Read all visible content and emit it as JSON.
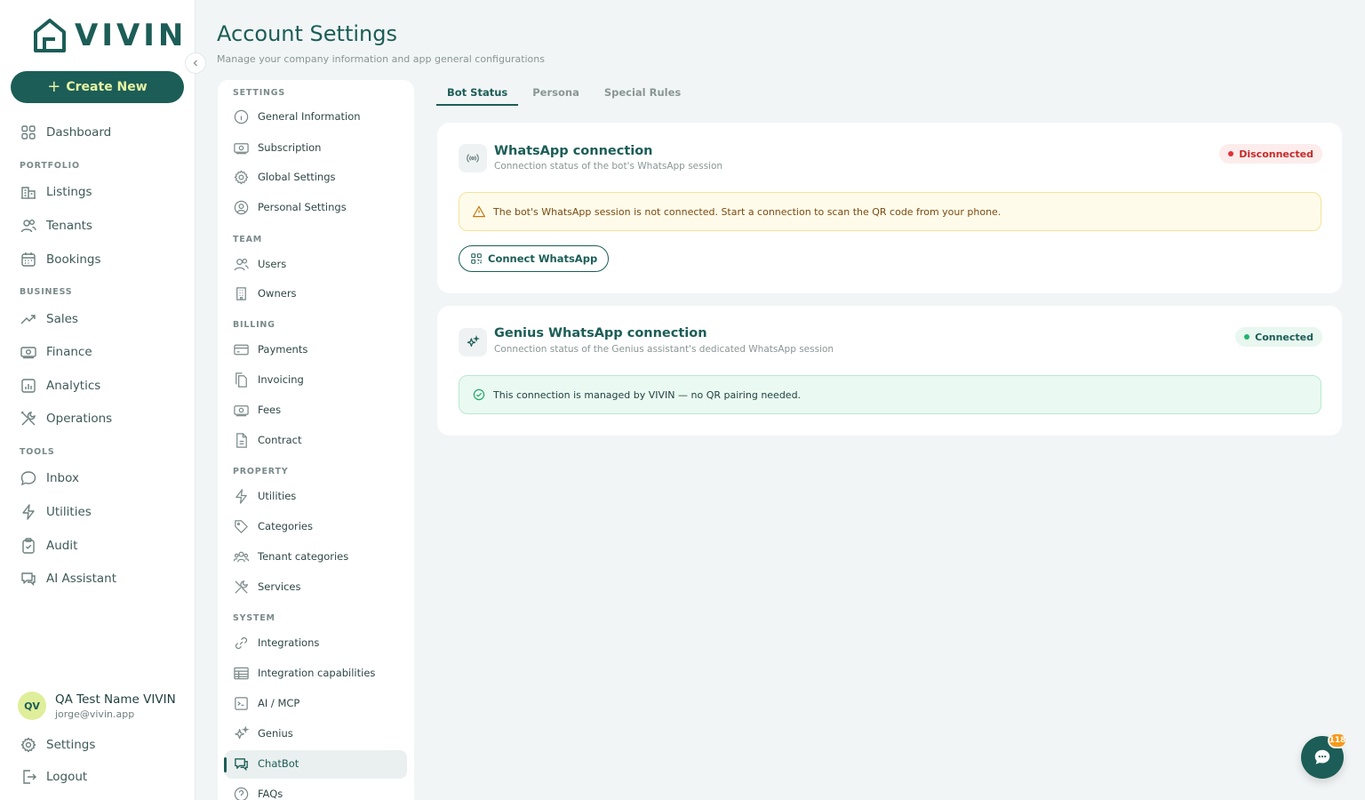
{
  "app": {
    "logo_text": "VIVIN",
    "brand_color": "#1c5e57",
    "accent_color": "#e7f3a3"
  },
  "sidebar": {
    "create_label": "Create New",
    "items": {
      "dashboard": "Dashboard",
      "portfolio_section": "PORTFOLIO",
      "listings": "Listings",
      "tenants": "Tenants",
      "bookings": "Bookings",
      "business_section": "BUSINESS",
      "sales": "Sales",
      "finance": "Finance",
      "analytics": "Analytics",
      "operations": "Operations",
      "tools_section": "TOOLS",
      "inbox": "Inbox",
      "utilities": "Utilities",
      "audit": "Audit",
      "ai_assistant": "AI Assistant"
    },
    "user": {
      "initials": "QV",
      "name": "QA Test Name VIVIN",
      "email": "jorge@vivin.app"
    },
    "settings_label": "Settings",
    "logout_label": "Logout"
  },
  "header": {
    "title": "Account Settings",
    "subtitle": "Manage your company information and app general configurations"
  },
  "settings_menu": {
    "settings_section": "SETTINGS",
    "general_information": "General Information",
    "subscription": "Subscription",
    "global_settings": "Global Settings",
    "personal_settings": "Personal Settings",
    "team_section": "TEAM",
    "users": "Users",
    "owners": "Owners",
    "billing_section": "BILLING",
    "payments": "Payments",
    "invoicing": "Invoicing",
    "fees": "Fees",
    "contract": "Contract",
    "property_section": "PROPERTY",
    "utilities": "Utilities",
    "categories": "Categories",
    "tenant_categories": "Tenant categories",
    "services": "Services",
    "system_section": "SYSTEM",
    "integrations": "Integrations",
    "integration_capabilities": "Integration capabilities",
    "ai_mcp": "AI / MCP",
    "genius": "Genius",
    "chatbot": "ChatBot",
    "faqs": "FAQs",
    "active_item": "chatbot"
  },
  "tabs": {
    "bot_status": "Bot Status",
    "persona": "Persona",
    "special_rules": "Special Rules",
    "active": "bot_status"
  },
  "whatsapp_card": {
    "title": "WhatsApp connection",
    "subtitle": "Connection status of the bot's WhatsApp session",
    "status": "Disconnected",
    "alert": "The bot's WhatsApp session is not connected. Start a connection to scan the QR code from your phone.",
    "button": "Connect WhatsApp"
  },
  "genius_card": {
    "title": "Genius WhatsApp connection",
    "subtitle": "Connection status of the Genius assistant's dedicated WhatsApp session",
    "status": "Connected",
    "alert": "This connection is managed by VIVIN — no QR pairing needed."
  },
  "chat_fab": {
    "badge": "118"
  }
}
